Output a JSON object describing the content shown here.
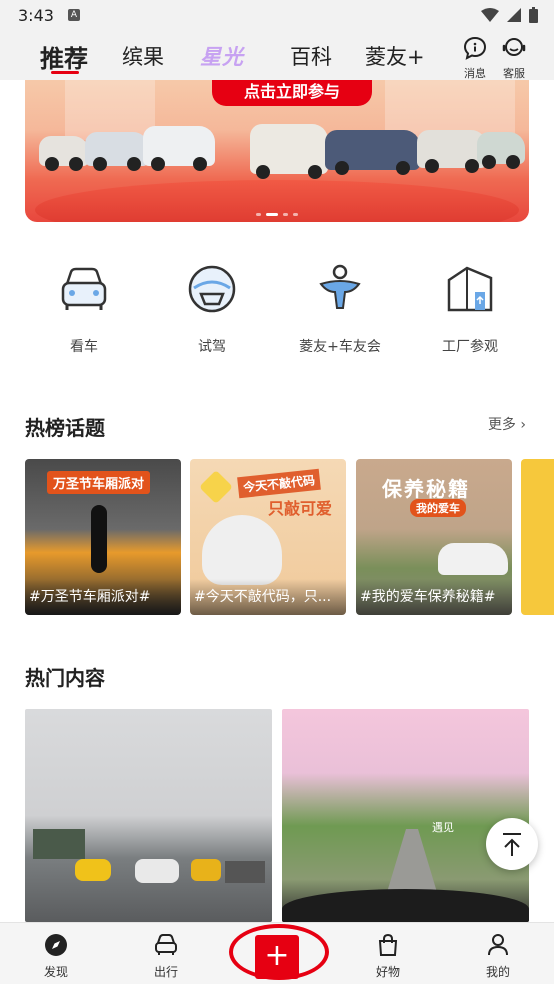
{
  "status_bar": {
    "time": "3:43",
    "notif_letter": "A"
  },
  "top_nav": {
    "tabs": [
      "推荐",
      "缤果",
      "星光",
      "百科",
      "菱友+"
    ],
    "active_tab": "推荐",
    "messages_label": "消息",
    "service_label": "客服"
  },
  "banner": {
    "cta": "点击立即参与"
  },
  "quick_entries": [
    "看车",
    "试驾",
    "菱友+车友会",
    "工厂参观"
  ],
  "hot_topics": {
    "title": "热榜话题",
    "more": "更多",
    "cards": [
      {
        "caption": "#万圣节车厢派对#",
        "overlay_text": "万圣节车厢派对"
      },
      {
        "caption": "#今天不敲代码，只...",
        "overlay_line1": "今天不敲代码",
        "overlay_line2": "只敲可爱"
      },
      {
        "caption": "#我的爱车保养秘籍#",
        "overlay_line1": "保养秘籍",
        "overlay_line2": "我的爱车"
      }
    ]
  },
  "hot_content": {
    "title": "热门内容",
    "cards": [
      {
        "overlay_text": ""
      },
      {
        "overlay_text": "遇见"
      }
    ]
  },
  "bottom_nav": {
    "items": [
      "发现",
      "出行",
      "+",
      "好物",
      "我的"
    ]
  },
  "colors": {
    "brand_red": "#e60012",
    "xingguang_purple": "#c7a2f2"
  }
}
